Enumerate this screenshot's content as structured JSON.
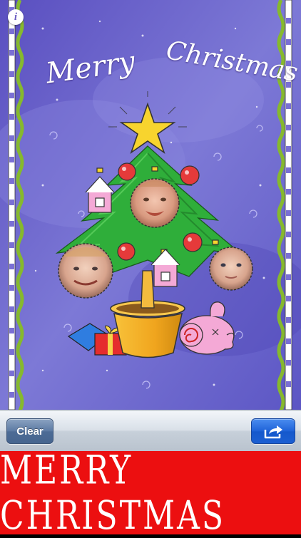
{
  "card": {
    "greeting_word1": "Merry",
    "greeting_word2": "Christmas",
    "info_glyph": "i",
    "background_color": "#6b62c9"
  },
  "toolbar": {
    "clear_label": "Clear",
    "share_icon": "share-arrow-icon"
  },
  "banner": {
    "text": "MERRY CHRISTMAS",
    "background_color": "#ec0f10"
  }
}
